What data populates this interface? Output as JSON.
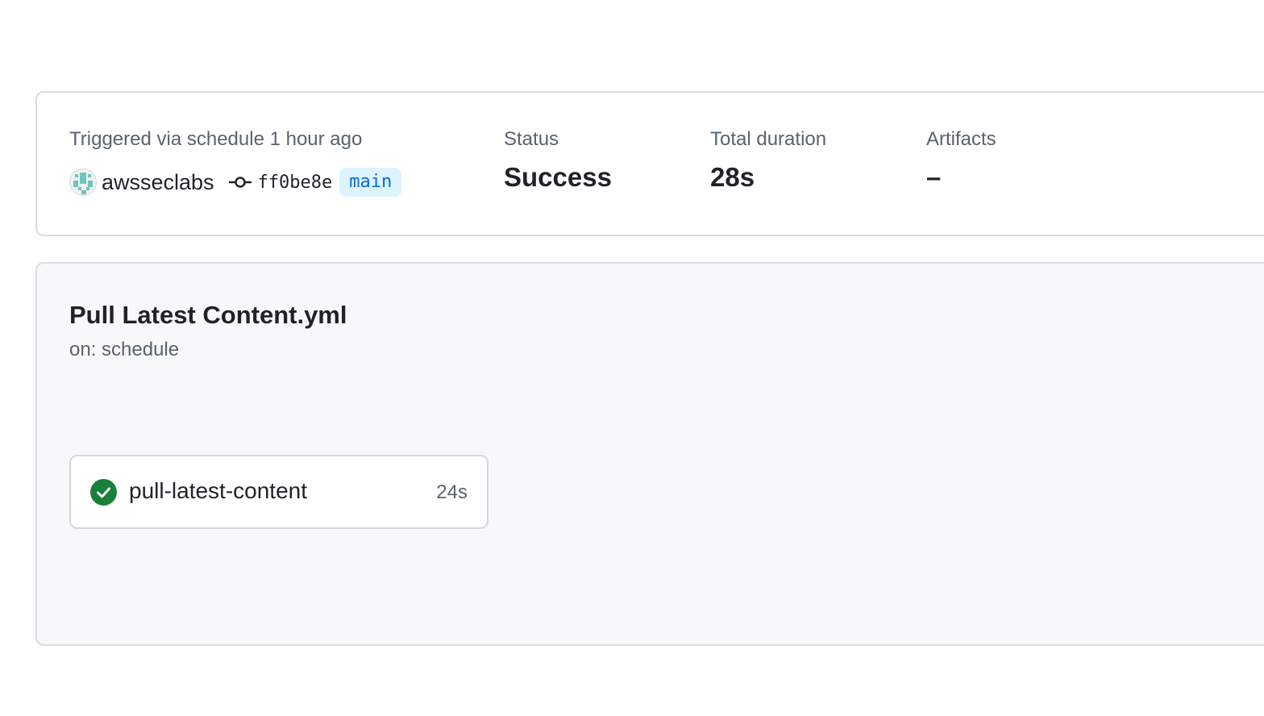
{
  "run_summary": {
    "trigger_text": "Triggered via schedule 1 hour ago",
    "actor": "awsseclabs",
    "commit_sha": "ff0be8e",
    "branch": "main",
    "status_label": "Status",
    "status_value": "Success",
    "duration_label": "Total duration",
    "duration_value": "28s",
    "artifacts_label": "Artifacts",
    "artifacts_value": "–"
  },
  "workflow": {
    "name": "Pull Latest Content.yml",
    "trigger": "on: schedule",
    "jobs": [
      {
        "name": "pull-latest-content",
        "duration": "24s",
        "status": "success",
        "status_icon": "check-circle-icon"
      }
    ]
  },
  "colors": {
    "success": "#1a7f37",
    "branch_text": "#0969da",
    "branch_bg": "#ddf4ff",
    "muted_text": "#59636e",
    "border": "#d8dee4",
    "canvas_subtle": "#f6f8fa"
  },
  "icons": {
    "avatar": "identicon-avatar",
    "commit": "git-commit-icon",
    "job_status": "check-circle-icon"
  }
}
